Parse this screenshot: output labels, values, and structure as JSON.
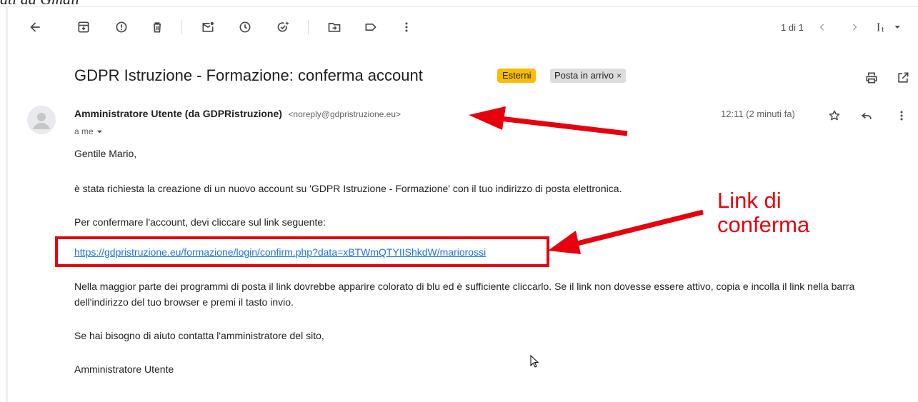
{
  "cropped_caption": "ati da Gmail",
  "toolbar": {
    "back": "back-arrow-icon",
    "archive": "archive-icon",
    "report": "report-spam-icon",
    "delete": "delete-icon",
    "mark_unread": "mark-unread-icon",
    "snooze": "snooze-icon",
    "add_task": "add-task-icon",
    "move_to": "move-to-icon",
    "labels": "label-icon",
    "more": "more-vert-icon",
    "pager": "1 di 1",
    "input_tools": "input-tools-icon"
  },
  "email": {
    "subject": "GDPR Istruzione - Formazione: conferma account",
    "labels": [
      {
        "text": "Esterni",
        "color": "#fbbc04"
      },
      {
        "text": "Posta in arrivo",
        "color": "#dddddd"
      }
    ],
    "sender_name": "Amministratore Utente (da GDPRistruzione)",
    "sender_email": "<noreply@gdpristruzione.eu>",
    "to": "a me",
    "time": "12:11 (2 minuti fa)",
    "greeting": "Gentile Mario,",
    "p1": "è stata richiesta la creazione di un nuovo account su 'GDPR Istruzione - Formazione' con il tuo indirizzo di posta elettronica.",
    "p2": "Per confermare l'account, devi cliccare sul link seguente:",
    "link": "https://gdpristruzione.eu/formazione/login/confirm.php?data=xBTWmQTYIIShkdW/mariorossi",
    "p3": "Nella maggior parte dei programmi di posta il link dovrebbe apparire colorato di blu ed è sufficiente cliccarlo. Se il link non dovesse essere attivo, copia e incolla il link nella barra dell'indirizzo del tuo browser e premi il tasto invio.",
    "p4": "Se hai bisogno di aiuto contatta l'amministratore del sito,",
    "signature": "Amministratore Utente"
  },
  "annotation": {
    "line1": "Link di",
    "line2": "conferma",
    "color": "#e8000d"
  }
}
